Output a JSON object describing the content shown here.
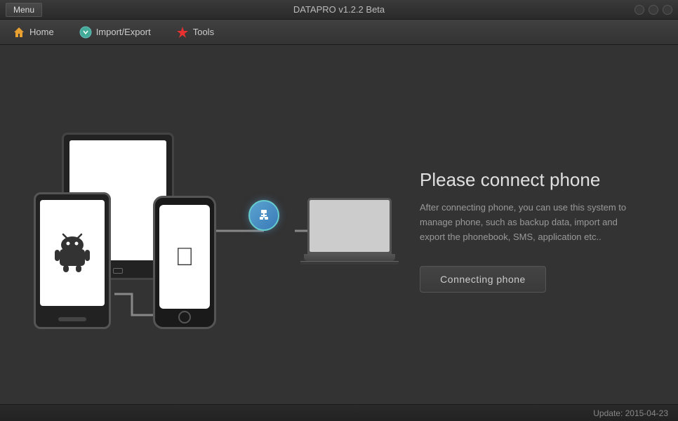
{
  "titleBar": {
    "menuLabel": "Menu",
    "appTitle": "DATAPRO v1.2.2 Beta"
  },
  "nav": {
    "homeLabel": "Home",
    "importLabel": "Import/Export",
    "toolsLabel": "Tools"
  },
  "mainPanel": {
    "heading": "Please connect phone",
    "description": "After connecting phone, you can use this system to manage phone, such as backup data, import and export the phonebook, SMS, application etc..",
    "connectingButton": "Connecting phone"
  },
  "statusBar": {
    "updateText": "Update: 2015-04-23"
  }
}
